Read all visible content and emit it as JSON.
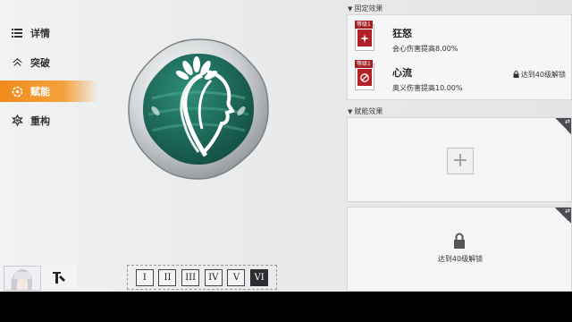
{
  "nav": {
    "items": [
      {
        "label": "详情",
        "icon": "list-icon"
      },
      {
        "label": "突破",
        "icon": "breakthrough-icon"
      },
      {
        "label": "赋能",
        "icon": "empower-icon",
        "active": true
      },
      {
        "label": "重构",
        "icon": "rebuild-icon"
      }
    ]
  },
  "tabs": [
    "I",
    "II",
    "III",
    "IV",
    "V",
    "VI"
  ],
  "selected_tab": "VI",
  "fixed_effects": {
    "title": "固定效果",
    "items": [
      {
        "level_tag": "等级1",
        "name": "狂怒",
        "desc": "会心伤害提高8.00%",
        "lock_text": ""
      },
      {
        "level_tag": "等级1",
        "name": "心流",
        "desc": "奥义伤害提高10.00%",
        "lock_text": "达到40级解锁"
      }
    ]
  },
  "empower_effects": {
    "title": "赋能效果",
    "slot2_lock_text": "达到40级解锁"
  },
  "colors": {
    "accent": "#f08a1c",
    "emblem_teal": "#1e6b5c",
    "level_red": "#a52023"
  }
}
